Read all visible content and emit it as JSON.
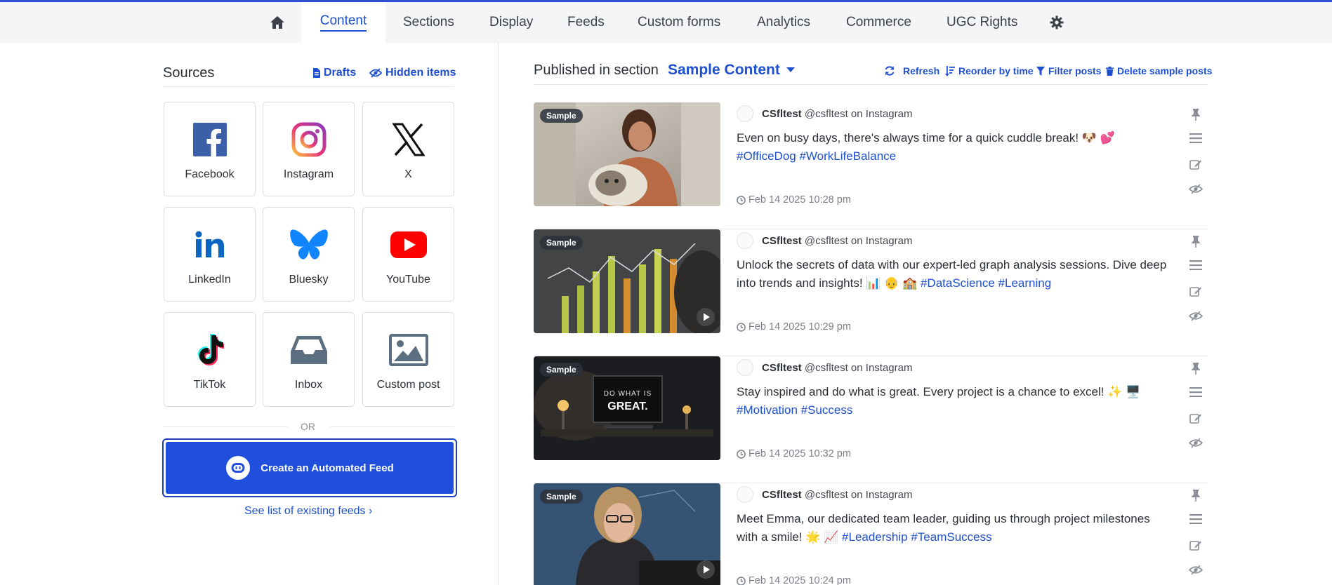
{
  "nav": {
    "home_icon": "home-icon",
    "tabs": [
      "Content",
      "Sections",
      "Display",
      "Feeds",
      "Custom forms",
      "Analytics",
      "Commerce",
      "UGC Rights"
    ],
    "settings_icon": "gear-icon",
    "accent": "#1e4fcf"
  },
  "sources": {
    "title": "Sources",
    "drafts": "Drafts",
    "hidden_items": "Hidden items",
    "tiles": [
      {
        "label": "Facebook",
        "icon": "facebook-icon"
      },
      {
        "label": "Instagram",
        "icon": "instagram-icon"
      },
      {
        "label": "X",
        "icon": "x-icon"
      },
      {
        "label": "LinkedIn",
        "icon": "linkedin-icon"
      },
      {
        "label": "Bluesky",
        "icon": "bluesky-icon"
      },
      {
        "label": "YouTube",
        "icon": "youtube-icon"
      },
      {
        "label": "TikTok",
        "icon": "tiktok-icon"
      },
      {
        "label": "Inbox",
        "icon": "inbox-icon"
      },
      {
        "label": "Custom post",
        "icon": "image-icon"
      }
    ],
    "or": "OR",
    "create_feed": "Create an Automated Feed",
    "see_list": "See list of existing feeds ›"
  },
  "section": {
    "label": "Published in section",
    "name": "Sample Content",
    "actions": {
      "refresh": "Refresh",
      "reorder": "Reorder by time",
      "filter": "Filter posts",
      "delete": "Delete sample posts"
    }
  },
  "posts": [
    {
      "badge": "Sample",
      "author": "CSfltest",
      "handle": "@csfltest on Instagram",
      "text": "Even on busy days, there's always time for a quick cuddle break! 🐶 💕",
      "tags": "#OfficeDog #WorkLifeBalance",
      "date": "Feb 14 2025 10:28 pm",
      "has_video": false
    },
    {
      "badge": "Sample",
      "author": "CSfltest",
      "handle": "@csfltest on Instagram",
      "text": "Unlock the secrets of data with our expert-led graph analysis sessions. Dive deep into trends and insights! 📊 👴 🏫",
      "tags": "#DataScience #Learning",
      "date": "Feb 14 2025 10:29 pm",
      "has_video": true
    },
    {
      "badge": "Sample",
      "author": "CSfltest",
      "handle": "@csfltest on Instagram",
      "text": "Stay inspired and do what is great. Every project is a chance to excel! ✨ 🖥️",
      "tags": "#Motivation #Success",
      "date": "Feb 14 2025 10:32 pm",
      "thumb_text_1": "DO WHAT IS",
      "thumb_text_2": "GREAT.",
      "has_video": false
    },
    {
      "badge": "Sample",
      "author": "CSfltest",
      "handle": "@csfltest on Instagram",
      "text": "Meet Emma, our dedicated team leader, guiding us through project milestones with a smile! 🌟 📈",
      "tags": "#Leadership #TeamSuccess",
      "date": "Feb 14 2025 10:24 pm",
      "has_video": true
    }
  ],
  "post_action_icons": [
    "pin-icon",
    "drag-handle-icon",
    "edit-icon",
    "hide-icon"
  ]
}
